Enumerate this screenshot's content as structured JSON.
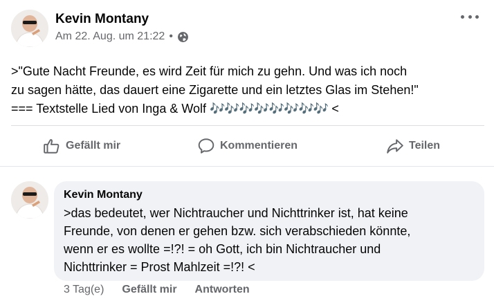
{
  "post": {
    "author": "Kevin Montany",
    "timestamp": "Am 22. Aug. um 21:22",
    "separator": "•",
    "privacy_icon": "globe-icon",
    "more_icon": "more-options-icon",
    "text_main": ">\"Gute Nacht Freunde, es wird Zeit für mich zu gehn. Und was ich noch\nzu sagen hätte, das dauert eine Zigarette und ein letztes Glas im Stehen!\"\n=== Textstelle Lied von Inga & Wolf ",
    "text_notes": "🎶🎶🎶🎶🎶🎶🎶🎶",
    "text_end": " <"
  },
  "actions": {
    "like_label": "Gefällt mir",
    "comment_label": "Kommentieren",
    "share_label": "Teilen"
  },
  "comment": {
    "author": "Kevin Montany",
    "text": ">das bedeutet, wer Nichtraucher und Nichttrinker ist, hat keine\nFreunde, von denen er gehen bzw. sich verabschieden könnte,\nwenn er es wollte =!?! = oh Gott, ich bin Nichtraucher und\nNichttrinker = Prost Mahlzeit =!?! <",
    "time": "3 Tag(e)",
    "like_label": "Gefällt mir",
    "reply_label": "Antworten"
  },
  "colors": {
    "secondary_text": "#65676b",
    "bubble_bg": "#f0f2f5",
    "divider": "#dcdde1"
  }
}
